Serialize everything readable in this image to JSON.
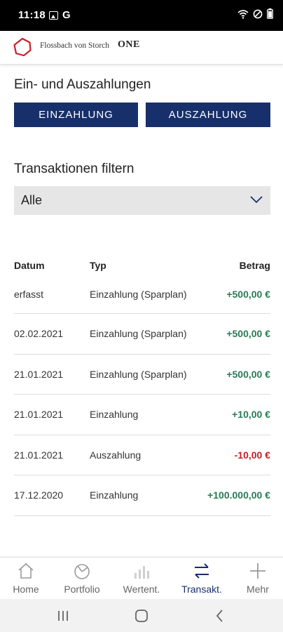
{
  "status_bar": {
    "time": "11:18",
    "icons": [
      "image-icon",
      "google-icon",
      "wifi-icon",
      "dnd-icon",
      "battery-icon"
    ]
  },
  "header": {
    "brand": "Flossbach von Storch",
    "product": "ONE"
  },
  "payments": {
    "title": "Ein- und Auszahlungen",
    "deposit_label": "EINZAHLUNG",
    "withdraw_label": "AUSZAHLUNG"
  },
  "filter": {
    "title": "Transaktionen filtern",
    "selected": "Alle"
  },
  "table": {
    "headers": {
      "date": "Datum",
      "type": "Typ",
      "amount": "Betrag"
    },
    "rows": [
      {
        "date": "erfasst",
        "type": "Einzahlung (Sparplan)",
        "amount": "+500,00 €",
        "sign": "pos"
      },
      {
        "date": "02.02.2021",
        "type": "Einzahlung (Sparplan)",
        "amount": "+500,00 €",
        "sign": "pos"
      },
      {
        "date": "21.01.2021",
        "type": "Einzahlung (Sparplan)",
        "amount": "+500,00 €",
        "sign": "pos"
      },
      {
        "date": "21.01.2021",
        "type": "Einzahlung",
        "amount": "+10,00 €",
        "sign": "pos"
      },
      {
        "date": "21.01.2021",
        "type": "Auszahlung",
        "amount": "-10,00 €",
        "sign": "neg"
      },
      {
        "date": "17.12.2020",
        "type": "Einzahlung",
        "amount": "+100.000,00 €",
        "sign": "pos"
      }
    ]
  },
  "bottom_nav": {
    "items": [
      {
        "label": "Home",
        "icon": "home-icon"
      },
      {
        "label": "Portfolio",
        "icon": "pie-chart-icon"
      },
      {
        "label": "Wertent.",
        "icon": "bar-chart-icon"
      },
      {
        "label": "Transakt.",
        "icon": "transfer-arrows-icon",
        "active": true
      },
      {
        "label": "Mehr",
        "icon": "plus-icon"
      }
    ]
  },
  "colors": {
    "primary": "#17306b",
    "positive": "#2a7a55",
    "negative": "#c4202a",
    "logo_red": "#c4202a"
  }
}
